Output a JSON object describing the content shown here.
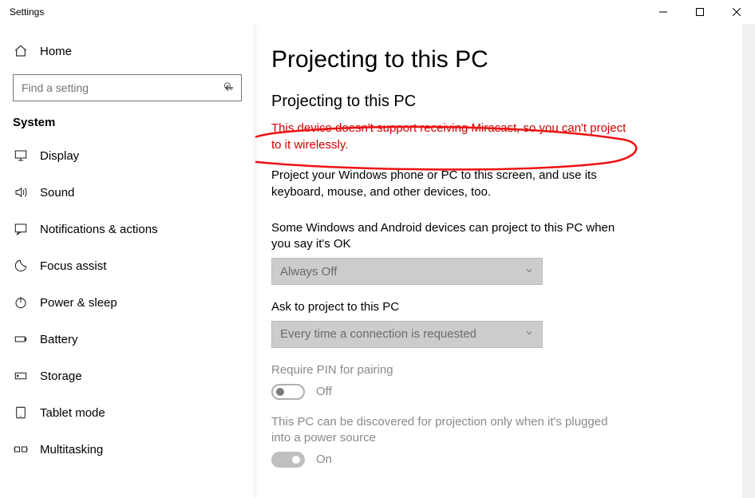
{
  "window": {
    "title": "Settings"
  },
  "sidebar": {
    "home_label": "Home",
    "search_placeholder": "Find a setting",
    "heading": "System",
    "items": [
      {
        "icon": "display-icon",
        "label": "Display"
      },
      {
        "icon": "sound-icon",
        "label": "Sound"
      },
      {
        "icon": "notifications-icon",
        "label": "Notifications & actions"
      },
      {
        "icon": "focus-assist-icon",
        "label": "Focus assist"
      },
      {
        "icon": "power-icon",
        "label": "Power & sleep"
      },
      {
        "icon": "battery-icon",
        "label": "Battery"
      },
      {
        "icon": "storage-icon",
        "label": "Storage"
      },
      {
        "icon": "tablet-icon",
        "label": "Tablet mode"
      },
      {
        "icon": "multitasking-icon",
        "label": "Multitasking"
      }
    ]
  },
  "content": {
    "page_title": "Projecting to this PC",
    "section_title": "Projecting to this PC",
    "error_message": "This device doesn't support receiving Miracast, so you can't project to it wirelessly.",
    "description": "Project your Windows phone or PC to this screen, and use its keyboard, mouse, and other devices, too.",
    "setting1": {
      "label": "Some Windows and Android devices can project to this PC when you say it's OK",
      "value": "Always Off"
    },
    "setting2": {
      "label": "Ask to project to this PC",
      "value": "Every time a connection is requested"
    },
    "setting3": {
      "label": "Require PIN for pairing",
      "value": "Off"
    },
    "setting4": {
      "label": "This PC can be discovered for projection only when it's plugged into a power source",
      "value": "On"
    }
  }
}
